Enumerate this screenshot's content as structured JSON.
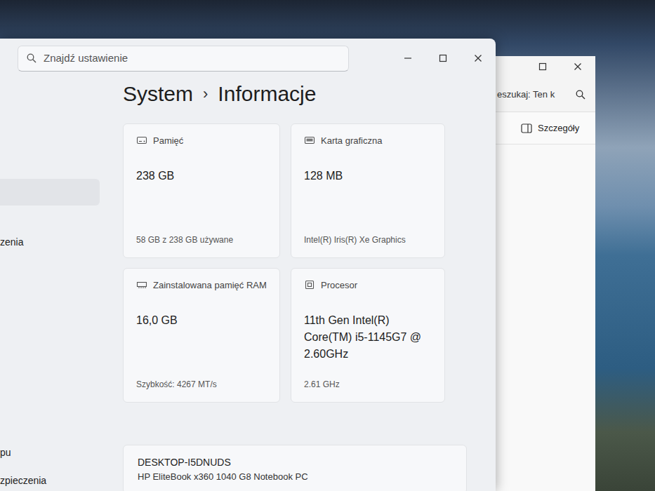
{
  "settings_window": {
    "search": {
      "placeholder": "Znajdź ustawienie"
    },
    "breadcrumb": {
      "parent": "System",
      "separator": "›",
      "current": "Informacje"
    },
    "sidebar": {
      "items": [
        {
          "label": "",
          "selected": true
        },
        {
          "label": "zenia",
          "selected": false
        },
        {
          "label": "pu",
          "selected": false
        },
        {
          "label": "zpieczenia",
          "selected": false
        }
      ]
    },
    "cards": [
      {
        "kind": "storage",
        "label": "Pamięć",
        "value": "238 GB",
        "detail": "58 GB z 238 GB używane"
      },
      {
        "kind": "gpu",
        "label": "Karta graficzna",
        "value": "128 MB",
        "detail": "Intel(R) Iris(R) Xe Graphics"
      },
      {
        "kind": "ram",
        "label": "Zainstalowana pamięć RAM",
        "value": "16,0 GB",
        "detail": "Szybkość: 4267 MT/s"
      },
      {
        "kind": "cpu",
        "label": "Procesor",
        "value": "11th Gen Intel(R) Core(TM) i5-1145G7 @ 2.60GHz",
        "detail": "2.61 GHz"
      }
    ],
    "device": {
      "name": "DESKTOP-I5DNUDS",
      "model": "HP EliteBook x360 1040 G8 Notebook PC"
    }
  },
  "explorer_window": {
    "search": {
      "placeholder": "eszukaj: Ten k"
    },
    "details_button": "Szczegóły"
  }
}
